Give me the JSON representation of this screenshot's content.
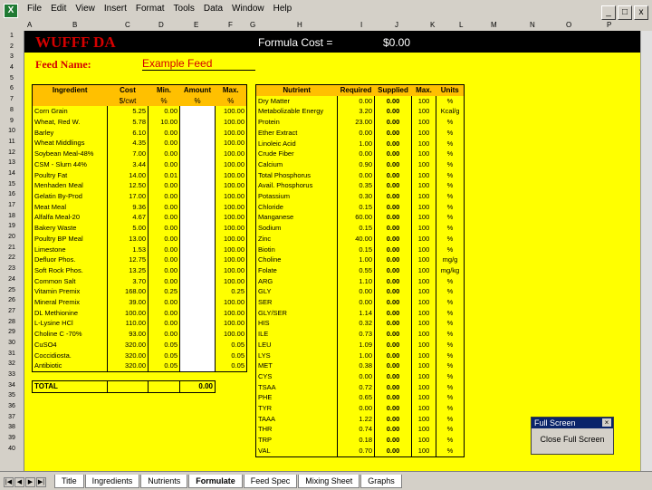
{
  "menu": [
    "File",
    "Edit",
    "View",
    "Insert",
    "Format",
    "Tools",
    "Data",
    "Window",
    "Help"
  ],
  "window_controls": [
    "_",
    "□",
    "x"
  ],
  "columns": [
    "A",
    "B",
    "C",
    "D",
    "E",
    "F",
    "G",
    "H",
    "I",
    "J",
    "K",
    "L",
    "M",
    "N",
    "O",
    "P"
  ],
  "rows": [
    "1",
    "2",
    "3",
    "4",
    "5",
    "6",
    "7",
    "8",
    "9",
    "10",
    "11",
    "12",
    "13",
    "14",
    "15",
    "16",
    "17",
    "18",
    "19",
    "20",
    "21",
    "22",
    "23",
    "24",
    "25",
    "26",
    "27",
    "28",
    "29",
    "30",
    "31",
    "32",
    "33",
    "34",
    "35",
    "36",
    "37",
    "38",
    "39",
    "40"
  ],
  "brand": "WUFFF DA",
  "formula_cost": {
    "label": "Formula Cost =",
    "value": "$0.00"
  },
  "feed_name": {
    "label": "Feed Name:",
    "value": "Example Feed"
  },
  "ingredients": {
    "headers": [
      "Ingredient",
      "Cost",
      "Min.",
      "Amount",
      "Max."
    ],
    "subheaders": [
      "",
      "$/cwt",
      "%",
      "%",
      "%"
    ],
    "rows": [
      [
        "Corn Grain",
        "5.25",
        "0.00",
        "",
        "100.00"
      ],
      [
        "Wheat, Red W.",
        "5.78",
        "10.00",
        "",
        "100.00"
      ],
      [
        "Barley",
        "6.10",
        "0.00",
        "",
        "100.00"
      ],
      [
        "Wheat Middlings",
        "4.35",
        "0.00",
        "",
        "100.00"
      ],
      [
        "Soybean Meal-48%",
        "7.00",
        "0.00",
        "",
        "100.00"
      ],
      [
        "CSM - Slurn 44%",
        "3.44",
        "0.00",
        "",
        "100.00"
      ],
      [
        "Poultry Fat",
        "14.00",
        "0.01",
        "",
        "100.00"
      ],
      [
        "Menhaden Meal",
        "12.50",
        "0.00",
        "",
        "100.00"
      ],
      [
        "Gelatin By-Prod",
        "17.00",
        "0.00",
        "",
        "100.00"
      ],
      [
        "Meat Meal",
        "9.36",
        "0.00",
        "",
        "100.00"
      ],
      [
        "Alfalfa Meal-20",
        "4.67",
        "0.00",
        "",
        "100.00"
      ],
      [
        "Bakery Waste",
        "5.00",
        "0.00",
        "",
        "100.00"
      ],
      [
        "Poultry BP Meal",
        "13.00",
        "0.00",
        "",
        "100.00"
      ],
      [
        "Limestone",
        "1.53",
        "0.00",
        "",
        "100.00"
      ],
      [
        "Defluor Phos.",
        "12.75",
        "0.00",
        "",
        "100.00"
      ],
      [
        "Soft Rock Phos.",
        "13.25",
        "0.00",
        "",
        "100.00"
      ],
      [
        "Common Salt",
        "3.70",
        "0.00",
        "",
        "100.00"
      ],
      [
        "Vitamin Premix",
        "168.00",
        "0.25",
        "",
        "0.25"
      ],
      [
        "Mineral Premix",
        "39.00",
        "0.00",
        "",
        "100.00"
      ],
      [
        "DL Methionine",
        "100.00",
        "0.00",
        "",
        "100.00"
      ],
      [
        "L-Lysine HCl",
        "110.00",
        "0.00",
        "",
        "100.00"
      ],
      [
        "Choline C -70%",
        "93.00",
        "0.00",
        "",
        "100.00"
      ],
      [
        "CuSO4",
        "320.00",
        "0.05",
        "",
        "0.05"
      ],
      [
        "Coccidiosta.",
        "320.00",
        "0.05",
        "",
        "0.05"
      ],
      [
        "Antibiotic",
        "320.00",
        "0.05",
        "",
        "0.05"
      ]
    ],
    "total_label": "TOTAL",
    "total_value": "0.00"
  },
  "nutrients": {
    "headers": [
      "Nutrient",
      "Required",
      "Supplied",
      "Max.",
      "Units"
    ],
    "rows": [
      [
        "Dry Matter",
        "0.00",
        "0.00",
        "100",
        "%"
      ],
      [
        "Metabolizable Energy",
        "3.20",
        "0.00",
        "100",
        "Kcal/g"
      ],
      [
        "Protein",
        "23.00",
        "0.00",
        "100",
        "%"
      ],
      [
        "Ether Extract",
        "0.00",
        "0.00",
        "100",
        "%"
      ],
      [
        "Linoleic Acid",
        "1.00",
        "0.00",
        "100",
        "%"
      ],
      [
        "Crude Fiber",
        "0.00",
        "0.00",
        "100",
        "%"
      ],
      [
        "Calcium",
        "0.90",
        "0.00",
        "100",
        "%"
      ],
      [
        "Total Phosphorus",
        "0.00",
        "0.00",
        "100",
        "%"
      ],
      [
        "Avail. Phosphorus",
        "0.35",
        "0.00",
        "100",
        "%"
      ],
      [
        "Potassium",
        "0.30",
        "0.00",
        "100",
        "%"
      ],
      [
        "Chloride",
        "0.15",
        "0.00",
        "100",
        "%"
      ],
      [
        "Manganese",
        "60.00",
        "0.00",
        "100",
        "%"
      ],
      [
        "Sodium",
        "0.15",
        "0.00",
        "100",
        "%"
      ],
      [
        "Zinc",
        "40.00",
        "0.00",
        "100",
        "%"
      ],
      [
        "Biotin",
        "0.15",
        "0.00",
        "100",
        "%"
      ],
      [
        "Choline",
        "1.00",
        "0.00",
        "100",
        "mg/g"
      ],
      [
        "Folate",
        "0.55",
        "0.00",
        "100",
        "mg/kg"
      ],
      [
        "ARG",
        "1.10",
        "0.00",
        "100",
        "%"
      ],
      [
        "GLY",
        "0.00",
        "0.00",
        "100",
        "%"
      ],
      [
        "SER",
        "0.00",
        "0.00",
        "100",
        "%"
      ],
      [
        "GLY/SER",
        "1.14",
        "0.00",
        "100",
        "%"
      ],
      [
        "HIS",
        "0.32",
        "0.00",
        "100",
        "%"
      ],
      [
        "ILE",
        "0.73",
        "0.00",
        "100",
        "%"
      ],
      [
        "LEU",
        "1.09",
        "0.00",
        "100",
        "%"
      ],
      [
        "LYS",
        "1.00",
        "0.00",
        "100",
        "%"
      ],
      [
        "MET",
        "0.38",
        "0.00",
        "100",
        "%"
      ],
      [
        "CYS",
        "0.00",
        "0.00",
        "100",
        "%"
      ],
      [
        "TSAA",
        "0.72",
        "0.00",
        "100",
        "%"
      ],
      [
        "PHE",
        "0.65",
        "0.00",
        "100",
        "%"
      ],
      [
        "TYR",
        "0.00",
        "0.00",
        "100",
        "%"
      ],
      [
        "TAAA",
        "1.22",
        "0.00",
        "100",
        "%"
      ],
      [
        "THR",
        "0.74",
        "0.00",
        "100",
        "%"
      ],
      [
        "TRP",
        "0.18",
        "0.00",
        "100",
        "%"
      ],
      [
        "VAL",
        "0.70",
        "0.00",
        "100",
        "%"
      ]
    ]
  },
  "popup": {
    "title": "Full Screen",
    "button": "Close Full Screen"
  },
  "tabs": [
    "Title",
    "Ingredients",
    "Nutrients",
    "Formulate",
    "Feed Spec",
    "Mixing Sheet",
    "Graphs"
  ],
  "active_tab": "Formulate",
  "colors": {
    "sheet_bg": "#ffff00",
    "header_fill": "#ffc000",
    "brand": "#d40000"
  }
}
